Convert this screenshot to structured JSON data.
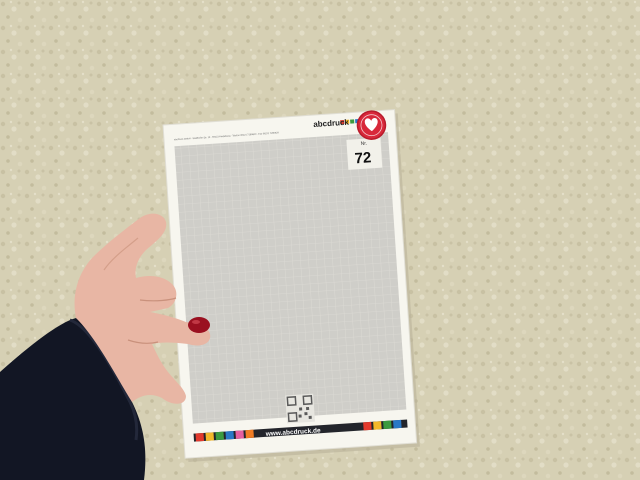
{
  "photo": {
    "card": {
      "brand": "abcdruck",
      "address_line": "abcdruck GmbH · Waldhofer Str. 19 · 69123 Heidelberg · Telefon 06221 7280600 · Fax 06221 7280629",
      "number_label": "Nr.",
      "number_value": "72",
      "website": "www.abcdruck.de"
    },
    "colors": {
      "wall": "#d6d0b4",
      "card": "#f7f6ef",
      "grid_area": "#cfcec9",
      "seal": "#d8283a",
      "nail_polish": "#9a1020",
      "sleeve": "#121624",
      "skin": "#e8b6a4"
    },
    "icons": [
      "heart-seal-icon",
      "qr-code-icon",
      "brand-color-squares-icon"
    ]
  }
}
